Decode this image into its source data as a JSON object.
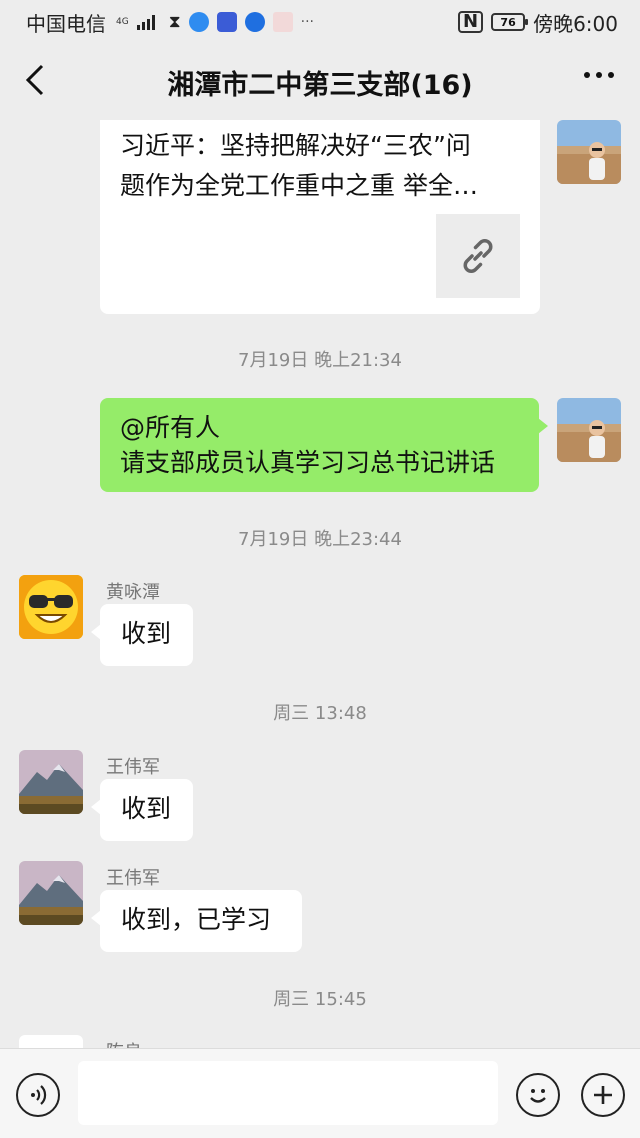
{
  "status_bar": {
    "carrier": "中国电信",
    "network": "4G",
    "battery": "76",
    "time": "傍晚6:00"
  },
  "header": {
    "title": "湘潭市二中第三支部(16)"
  },
  "messages": {
    "link_card": {
      "text": "习近平：坚持把解决好“三农”问\n题作为全党工作重中之重 举全…"
    },
    "ts1": "7月19日 晚上21:34",
    "out1": {
      "line1": "@所有人",
      "line2": "请支部成员认真学习习总书记讲话"
    },
    "ts2": "7月19日 晚上23:44",
    "m1": {
      "sender": "黄咏潭",
      "text": "收到"
    },
    "ts3": "周三 13:48",
    "m2": {
      "sender": "王伟军",
      "text": "收到"
    },
    "m3": {
      "sender": "王伟军",
      "text": "收到，已学习"
    },
    "ts4": "周三 15:45",
    "m4": {
      "sender": "陈良"
    }
  },
  "input_bar": {
    "value": ""
  },
  "colors": {
    "background": "#ededed",
    "outgoing_bubble": "#95ec69",
    "incoming_bubble": "#ffffff"
  },
  "icons": [
    "back-icon",
    "more-icon",
    "link-icon",
    "voice-icon",
    "emoji-icon",
    "plus-icon"
  ]
}
